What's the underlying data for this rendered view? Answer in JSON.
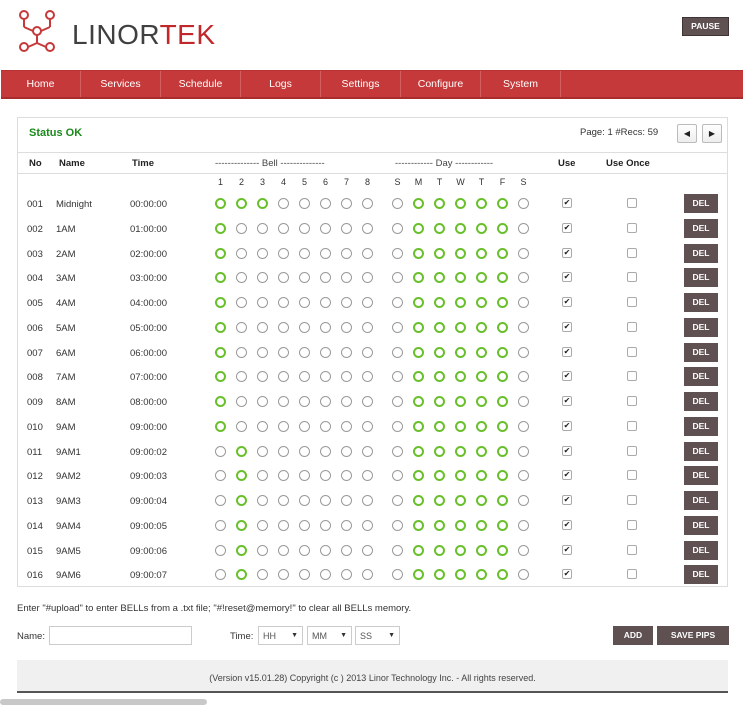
{
  "header": {
    "logo_part1": "LINOR",
    "logo_part2": "TEK",
    "pause_label": "PAUSE",
    "brand_color": "#c6393a",
    "button_color": "#5f5152"
  },
  "nav": [
    "Home",
    "Services",
    "Schedule",
    "Logs",
    "Settings",
    "Configure",
    "System"
  ],
  "panel": {
    "status": "Status OK",
    "page_info": "Page: 1 #Recs: 59",
    "prev_icon": "◀",
    "next_icon": "▶"
  },
  "columns": {
    "no": "No",
    "name": "Name",
    "time": "Time",
    "bell": "-------------- Bell --------------",
    "day": "------------ Day ------------",
    "use": "Use",
    "use_once": "Use Once"
  },
  "bell_numbers": [
    "1",
    "2",
    "3",
    "4",
    "5",
    "6",
    "7",
    "8"
  ],
  "day_letters": [
    "S",
    "M",
    "T",
    "W",
    "T",
    "F",
    "S"
  ],
  "rows": [
    {
      "no": "001",
      "name": "Midnight",
      "time": "00:00:00",
      "bells": [
        1,
        1,
        1,
        0,
        0,
        0,
        0,
        0
      ],
      "days": [
        0,
        1,
        1,
        1,
        1,
        1,
        0
      ],
      "use": true,
      "use_once": false,
      "del": "DEL"
    },
    {
      "no": "002",
      "name": "1AM",
      "time": "01:00:00",
      "bells": [
        1,
        0,
        0,
        0,
        0,
        0,
        0,
        0
      ],
      "days": [
        0,
        1,
        1,
        1,
        1,
        1,
        0
      ],
      "use": true,
      "use_once": false,
      "del": "DEL"
    },
    {
      "no": "003",
      "name": "2AM",
      "time": "02:00:00",
      "bells": [
        1,
        0,
        0,
        0,
        0,
        0,
        0,
        0
      ],
      "days": [
        0,
        1,
        1,
        1,
        1,
        1,
        0
      ],
      "use": true,
      "use_once": false,
      "del": "DEL"
    },
    {
      "no": "004",
      "name": "3AM",
      "time": "03:00:00",
      "bells": [
        1,
        0,
        0,
        0,
        0,
        0,
        0,
        0
      ],
      "days": [
        0,
        1,
        1,
        1,
        1,
        1,
        0
      ],
      "use": true,
      "use_once": false,
      "del": "DEL"
    },
    {
      "no": "005",
      "name": "4AM",
      "time": "04:00:00",
      "bells": [
        1,
        0,
        0,
        0,
        0,
        0,
        0,
        0
      ],
      "days": [
        0,
        1,
        1,
        1,
        1,
        1,
        0
      ],
      "use": true,
      "use_once": false,
      "del": "DEL"
    },
    {
      "no": "006",
      "name": "5AM",
      "time": "05:00:00",
      "bells": [
        1,
        0,
        0,
        0,
        0,
        0,
        0,
        0
      ],
      "days": [
        0,
        1,
        1,
        1,
        1,
        1,
        0
      ],
      "use": true,
      "use_once": false,
      "del": "DEL"
    },
    {
      "no": "007",
      "name": "6AM",
      "time": "06:00:00",
      "bells": [
        1,
        0,
        0,
        0,
        0,
        0,
        0,
        0
      ],
      "days": [
        0,
        1,
        1,
        1,
        1,
        1,
        0
      ],
      "use": true,
      "use_once": false,
      "del": "DEL"
    },
    {
      "no": "008",
      "name": "7AM",
      "time": "07:00:00",
      "bells": [
        1,
        0,
        0,
        0,
        0,
        0,
        0,
        0
      ],
      "days": [
        0,
        1,
        1,
        1,
        1,
        1,
        0
      ],
      "use": true,
      "use_once": false,
      "del": "DEL"
    },
    {
      "no": "009",
      "name": "8AM",
      "time": "08:00:00",
      "bells": [
        1,
        0,
        0,
        0,
        0,
        0,
        0,
        0
      ],
      "days": [
        0,
        1,
        1,
        1,
        1,
        1,
        0
      ],
      "use": true,
      "use_once": false,
      "del": "DEL"
    },
    {
      "no": "010",
      "name": "9AM",
      "time": "09:00:00",
      "bells": [
        1,
        0,
        0,
        0,
        0,
        0,
        0,
        0
      ],
      "days": [
        0,
        1,
        1,
        1,
        1,
        1,
        0
      ],
      "use": true,
      "use_once": false,
      "del": "DEL"
    },
    {
      "no": "011",
      "name": "9AM1",
      "time": "09:00:02",
      "bells": [
        0,
        1,
        0,
        0,
        0,
        0,
        0,
        0
      ],
      "days": [
        0,
        1,
        1,
        1,
        1,
        1,
        0
      ],
      "use": true,
      "use_once": false,
      "del": "DEL"
    },
    {
      "no": "012",
      "name": "9AM2",
      "time": "09:00:03",
      "bells": [
        0,
        1,
        0,
        0,
        0,
        0,
        0,
        0
      ],
      "days": [
        0,
        1,
        1,
        1,
        1,
        1,
        0
      ],
      "use": true,
      "use_once": false,
      "del": "DEL"
    },
    {
      "no": "013",
      "name": "9AM3",
      "time": "09:00:04",
      "bells": [
        0,
        1,
        0,
        0,
        0,
        0,
        0,
        0
      ],
      "days": [
        0,
        1,
        1,
        1,
        1,
        1,
        0
      ],
      "use": true,
      "use_once": false,
      "del": "DEL"
    },
    {
      "no": "014",
      "name": "9AM4",
      "time": "09:00:05",
      "bells": [
        0,
        1,
        0,
        0,
        0,
        0,
        0,
        0
      ],
      "days": [
        0,
        1,
        1,
        1,
        1,
        1,
        0
      ],
      "use": true,
      "use_once": false,
      "del": "DEL"
    },
    {
      "no": "015",
      "name": "9AM5",
      "time": "09:00:06",
      "bells": [
        0,
        1,
        0,
        0,
        0,
        0,
        0,
        0
      ],
      "days": [
        0,
        1,
        1,
        1,
        1,
        1,
        0
      ],
      "use": true,
      "use_once": false,
      "del": "DEL"
    },
    {
      "no": "016",
      "name": "9AM6",
      "time": "09:00:07",
      "bells": [
        0,
        1,
        0,
        0,
        0,
        0,
        0,
        0
      ],
      "days": [
        0,
        1,
        1,
        1,
        1,
        1,
        0
      ],
      "use": true,
      "use_once": false,
      "del": "DEL"
    }
  ],
  "hint": "Enter \"#upload\" to enter BELLs from a .txt file; \"#!reset@memory!\" to clear all BELLs memory.",
  "form": {
    "name_label": "Name:",
    "name_value": "",
    "time_label": "Time:",
    "hh": "HH",
    "mm": "MM",
    "ss": "SS",
    "add_label": "ADD",
    "save_label": "SAVE PIPS"
  },
  "footer": "(Version v15.01.28) Copyright (c ) 2013 Linor Technology Inc. - All rights reserved."
}
